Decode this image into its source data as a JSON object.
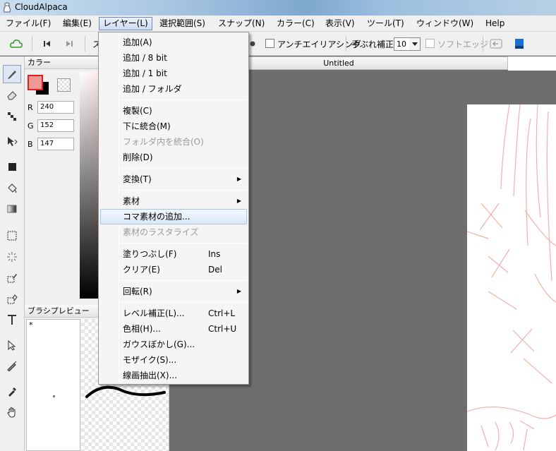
{
  "window": {
    "title": "CloudAlpaca"
  },
  "menubar": [
    {
      "label": "ファイル(F)"
    },
    {
      "label": "編集(E)"
    },
    {
      "label": "レイヤー(L)"
    },
    {
      "label": "選択範囲(S)"
    },
    {
      "label": "スナップ(N)"
    },
    {
      "label": "カラー(C)"
    },
    {
      "label": "表示(V)"
    },
    {
      "label": "ツール(T)"
    },
    {
      "label": "ウィンドウ(W)"
    },
    {
      "label": "Help"
    }
  ],
  "toolbar": {
    "partial_label": "ス",
    "antialias_label": "アンチエイリアシング",
    "stabilizer_label": "手ぶれ補正",
    "stabilizer_value": "10",
    "softedge_label": "ソフトエッジ"
  },
  "color_panel": {
    "title": "カラー",
    "r_label": "R",
    "r_value": "240",
    "g_label": "G",
    "g_value": "152",
    "b_label": "B",
    "b_value": "147",
    "foreground_color": "#f09893"
  },
  "brush_preview": {
    "title": "ブラシプレビュー",
    "mark": "*"
  },
  "document": {
    "tab_title": "Untitled"
  },
  "layer_menu": {
    "items": [
      {
        "label": "追加(A)"
      },
      {
        "label": "追加 / 8 bit"
      },
      {
        "label": "追加 / 1 bit"
      },
      {
        "label": "追加 / フォルダ"
      },
      {
        "label": "複製(C)"
      },
      {
        "label": "下に統合(M)"
      },
      {
        "label": "フォルダ内を統合(O)"
      },
      {
        "label": "削除(D)"
      },
      {
        "label": "変換(T)"
      },
      {
        "label": "素材"
      },
      {
        "label": "コマ素材の追加..."
      },
      {
        "label": "素材のラスタライズ"
      },
      {
        "label": "塗りつぶし(F)",
        "shortcut": "Ins"
      },
      {
        "label": "クリア(E)",
        "shortcut": "Del"
      },
      {
        "label": "回転(R)"
      },
      {
        "label": "レベル補正(L)...",
        "shortcut": "Ctrl+L"
      },
      {
        "label": "色相(H)...",
        "shortcut": "Ctrl+U"
      },
      {
        "label": "ガウスぼかし(G)..."
      },
      {
        "label": "モザイク(S)..."
      },
      {
        "label": "線画抽出(X)..."
      }
    ]
  }
}
